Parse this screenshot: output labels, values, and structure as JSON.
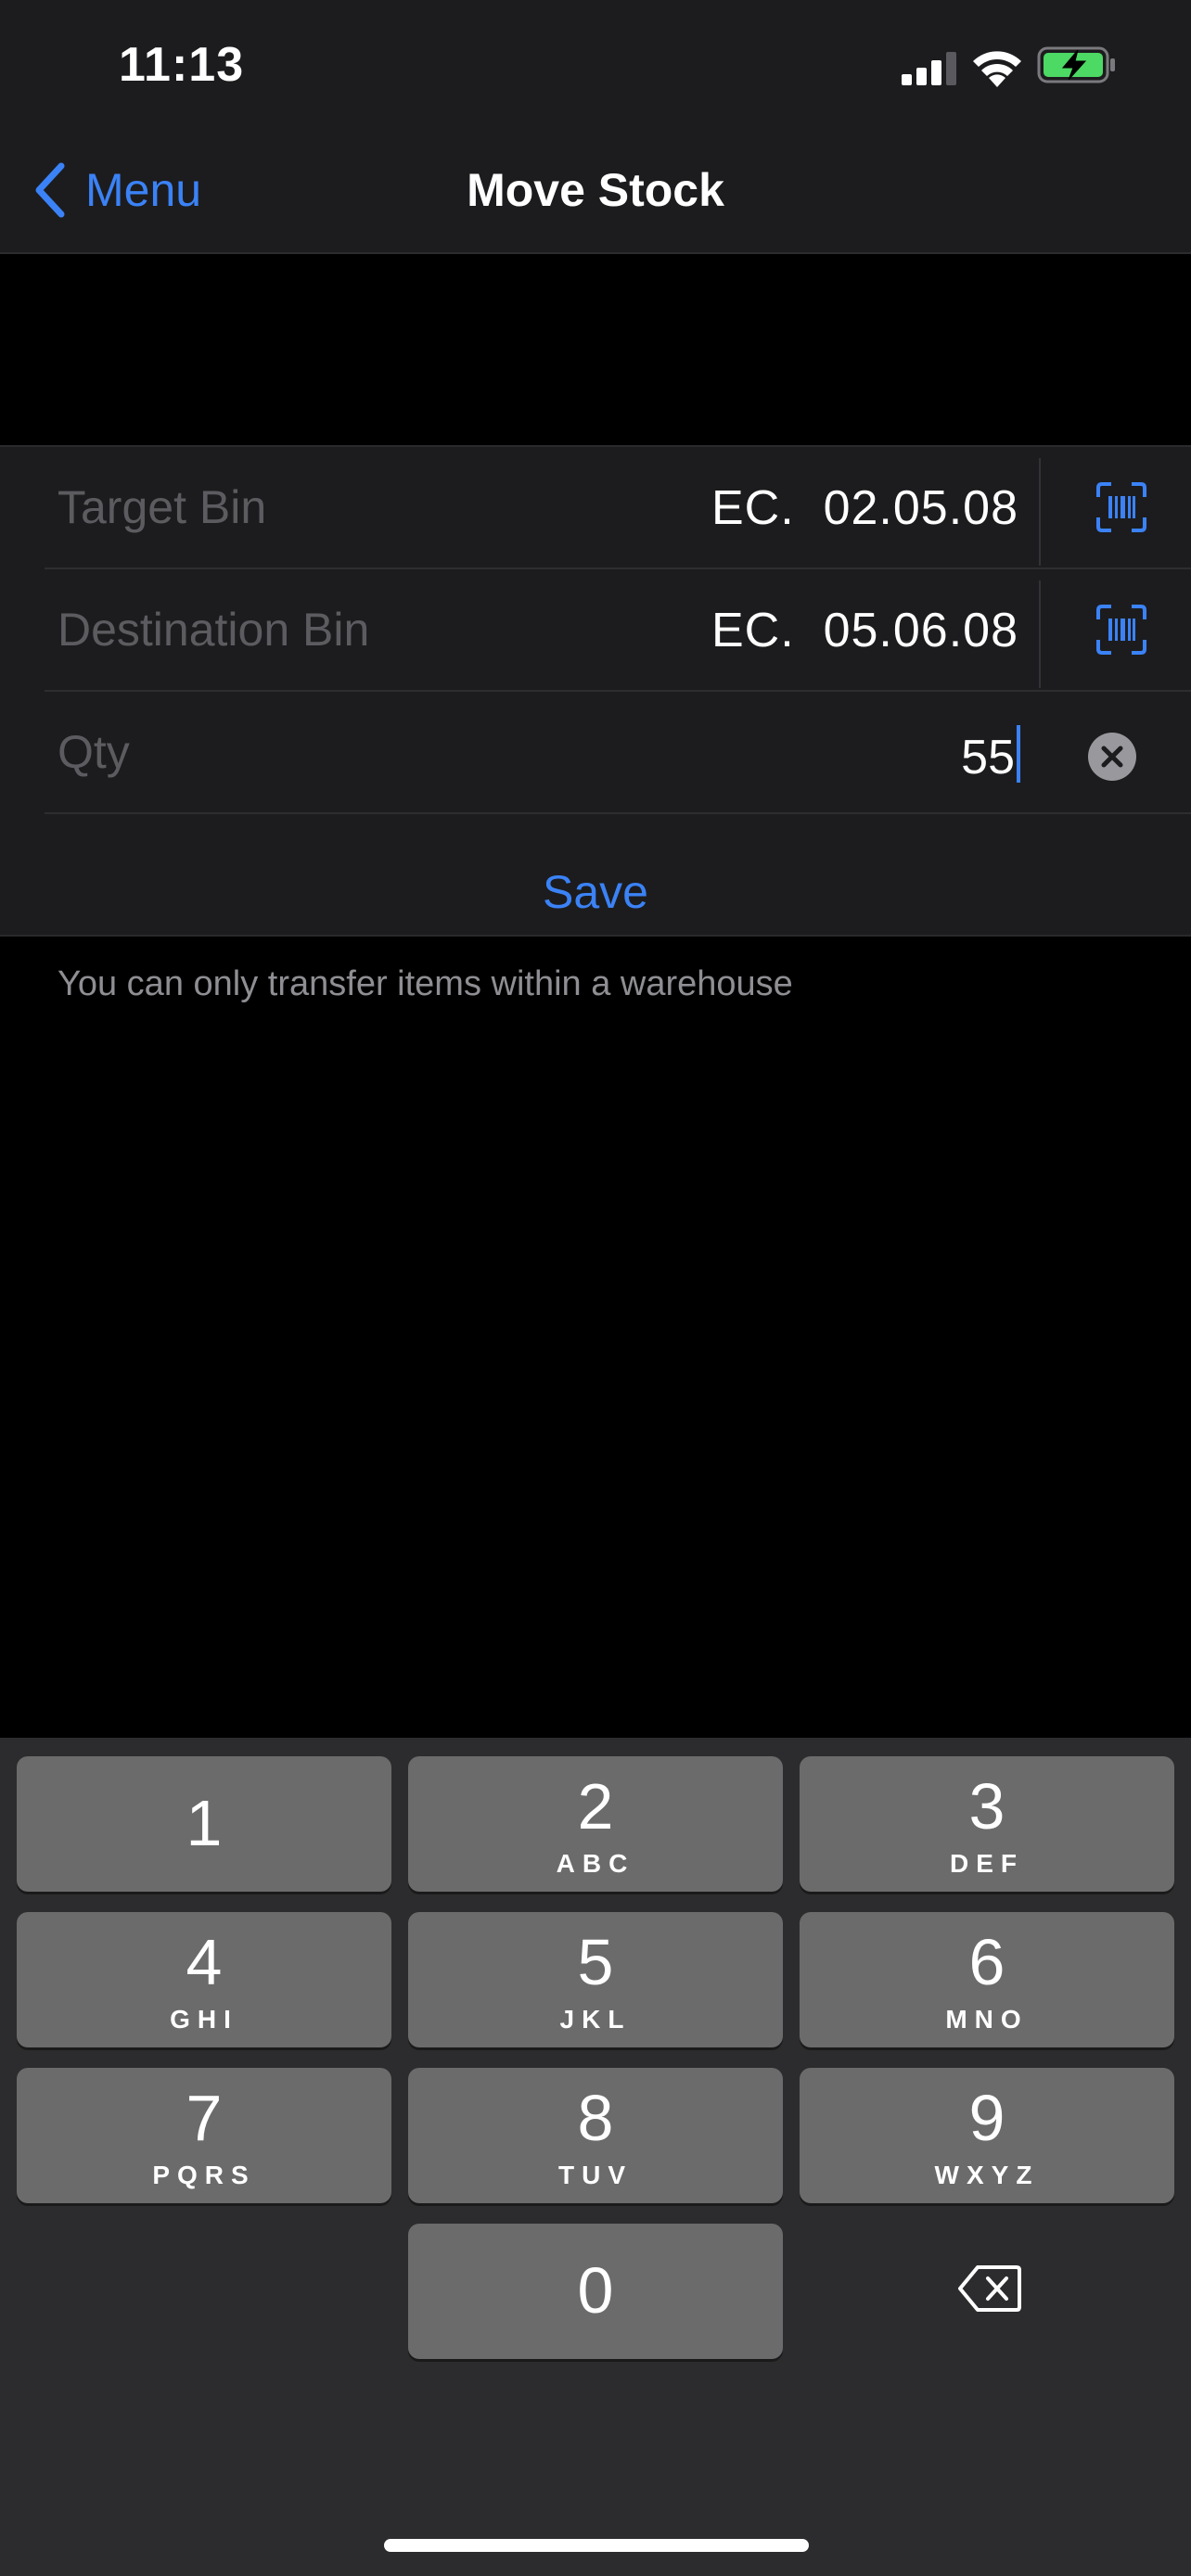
{
  "status": {
    "time": "11:13"
  },
  "nav": {
    "back_label": "Menu",
    "title": "Move Stock"
  },
  "form": {
    "target_bin": {
      "label": "Target Bin",
      "value": "EC.  02.05.08"
    },
    "destination_bin": {
      "label": "Destination Bin",
      "value": "EC.  05.06.08"
    },
    "qty": {
      "label": "Qty",
      "value": "55"
    },
    "save_label": "Save",
    "footnote": "You can only transfer items within a warehouse"
  },
  "keyboard": {
    "keys": [
      {
        "digit": "1",
        "letters": ""
      },
      {
        "digit": "2",
        "letters": "ABC"
      },
      {
        "digit": "3",
        "letters": "DEF"
      },
      {
        "digit": "4",
        "letters": "GHI"
      },
      {
        "digit": "5",
        "letters": "JKL"
      },
      {
        "digit": "6",
        "letters": "MNO"
      },
      {
        "digit": "7",
        "letters": "PQRS"
      },
      {
        "digit": "8",
        "letters": "TUV"
      },
      {
        "digit": "9",
        "letters": "WXYZ"
      },
      {
        "digit": "0",
        "letters": ""
      }
    ]
  },
  "colors": {
    "accent": "#3b82f6",
    "battery": "#4cd964",
    "background": "#000000",
    "surface": "#1c1c1e"
  }
}
